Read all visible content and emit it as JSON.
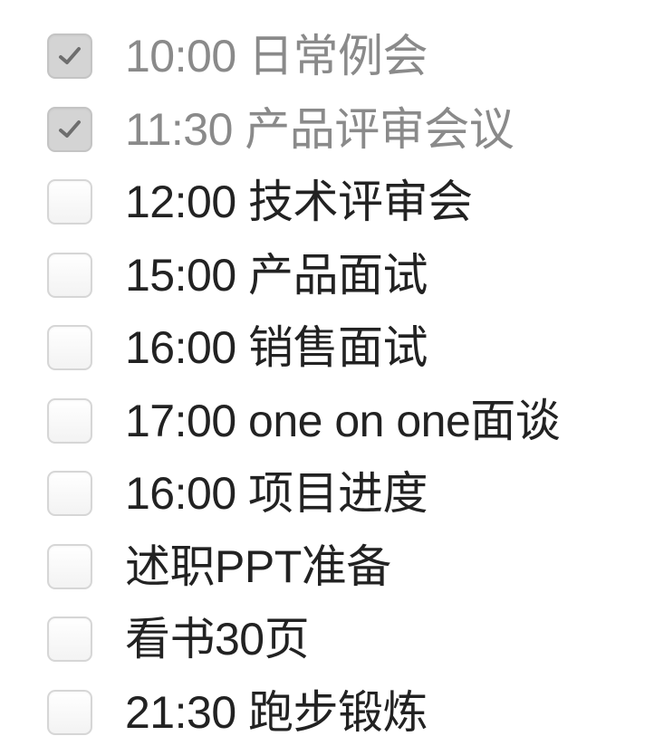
{
  "todos": [
    {
      "text": "10:00 日常例会",
      "checked": true
    },
    {
      "text": "11:30 产品评审会议",
      "checked": true
    },
    {
      "text": "12:00 技术评审会",
      "checked": false
    },
    {
      "text": "15:00 产品面试",
      "checked": false
    },
    {
      "text": "16:00 销售面试",
      "checked": false
    },
    {
      "text": "17:00 one on one面谈",
      "checked": false
    },
    {
      "text": "16:00 项目进度",
      "checked": false
    },
    {
      "text": "述职PPT准备",
      "checked": false
    },
    {
      "text": "看书30页",
      "checked": false
    },
    {
      "text": "21:30 跑步锻炼",
      "checked": false
    }
  ],
  "icons": {
    "checkbox_checked": "checkmark-icon"
  },
  "colors": {
    "done_text": "#8a8a8a",
    "pending_text": "#222222",
    "checkbox_border": "#d6d6d6",
    "checkbox_checked_fill": "#d4d4d4",
    "checkmark": "#6e6e6e"
  }
}
